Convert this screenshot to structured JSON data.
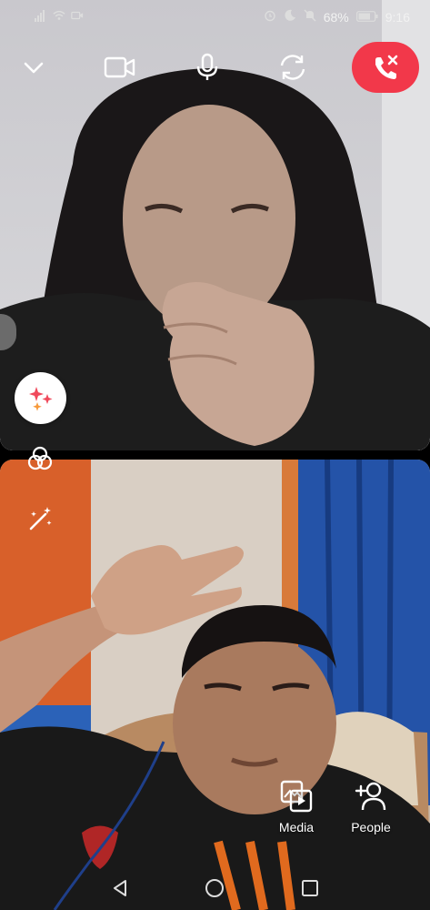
{
  "status_bar": {
    "battery_text": "68%",
    "time": "9:16"
  },
  "call_controls": {
    "minimize_icon": "chevron-down-icon",
    "camera_icon": "video-camera-icon",
    "mic_icon": "microphone-icon",
    "flip_icon": "switch-camera-icon",
    "end_call_icon": "end-call-icon",
    "end_call_color": "#f2384a"
  },
  "side_tools": [
    "sparkle-effects-icon",
    "color-filter-icon",
    "magic-wand-icon"
  ],
  "actions": [
    {
      "label": "Media",
      "icon": "media-icon"
    },
    {
      "label": "People",
      "icon": "add-person-icon"
    }
  ],
  "nav": [
    "back-icon",
    "home-icon",
    "recents-icon"
  ]
}
